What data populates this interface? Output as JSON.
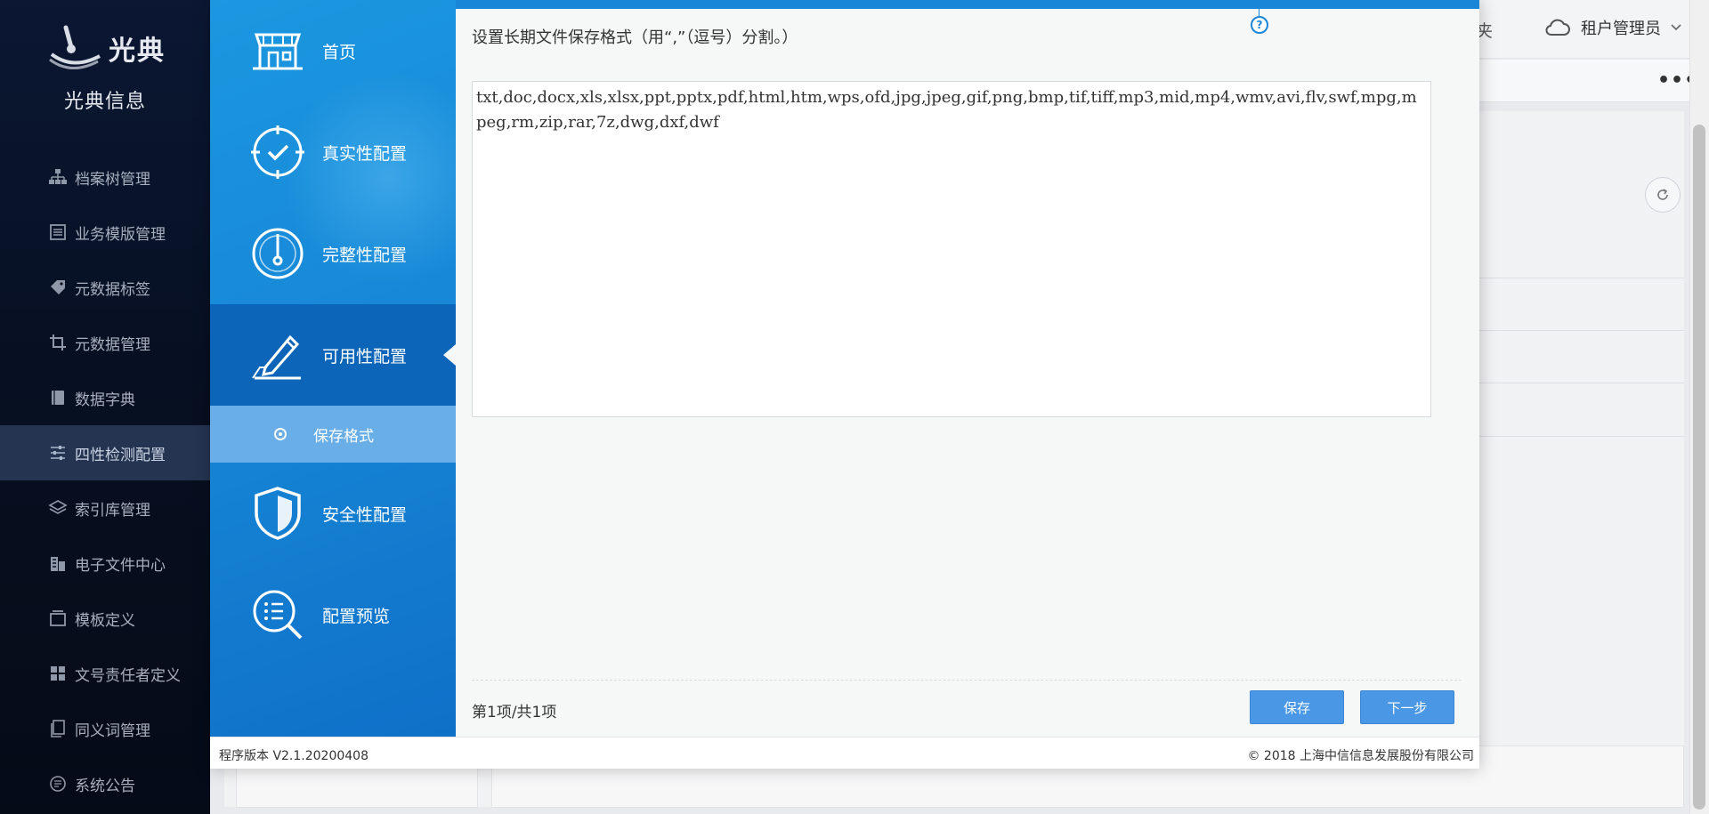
{
  "brand": {
    "logo_text": "光典",
    "name": "光典信息"
  },
  "sidebar": {
    "items": [
      {
        "label": "档案树管理",
        "icon": "tree-structure-icon"
      },
      {
        "label": "业务模版管理",
        "icon": "list-template-icon"
      },
      {
        "label": "元数据标签",
        "icon": "tag-icon"
      },
      {
        "label": "元数据管理",
        "icon": "crop-icon"
      },
      {
        "label": "数据字典",
        "icon": "book-icon"
      },
      {
        "label": "四性检测配置",
        "icon": "sliders-icon",
        "active": true
      },
      {
        "label": "索引库管理",
        "icon": "layers-icon"
      },
      {
        "label": "电子文件中心",
        "icon": "building-icon"
      },
      {
        "label": "模板定义",
        "icon": "window-icon"
      },
      {
        "label": "文号责任者定义",
        "icon": "grid-icon"
      },
      {
        "label": "同义词管理",
        "icon": "document-copy-icon"
      },
      {
        "label": "系统公告",
        "icon": "chat-bubble-icon"
      }
    ]
  },
  "header": {
    "fragment": "夹",
    "user": "租户管理员",
    "more": "•••"
  },
  "steps": [
    {
      "label": "首页",
      "icon": "storefront-icon"
    },
    {
      "label": "真实性配置",
      "icon": "target-check-icon"
    },
    {
      "label": "完整性配置",
      "icon": "gauge-icon"
    },
    {
      "label": "可用性配置",
      "icon": "pen-edit-icon",
      "active": true
    },
    {
      "label": "安全性配置",
      "icon": "shield-icon"
    },
    {
      "label": "配置预览",
      "icon": "search-list-icon"
    }
  ],
  "substep": {
    "label": "保存格式"
  },
  "content": {
    "description": "设置长期文件保存格式（用“,”（逗号）分割。）",
    "formats": "txt,doc,docx,xls,xlsx,ppt,pptx,pdf,html,htm,wps,ofd,jpg,jpeg,gif,png,bmp,tif,tiff,mp3,mid,mp4,wmv,avi,flv,swf,mpg,mpeg,rm,zip,rar,7z,dwg,dxf,dwf",
    "help": "?"
  },
  "pagination": {
    "text": "第1项/共1项"
  },
  "buttons": {
    "save": "保存",
    "next": "下一步"
  },
  "footer": {
    "version": "程序版本 V2.1.20200408",
    "copyright": "© 2018 上海中信信息发展股份有限公司"
  },
  "colors": {
    "accent": "#1a86d8",
    "sidebar_bg": "#071022",
    "button": "#4a97e6"
  }
}
